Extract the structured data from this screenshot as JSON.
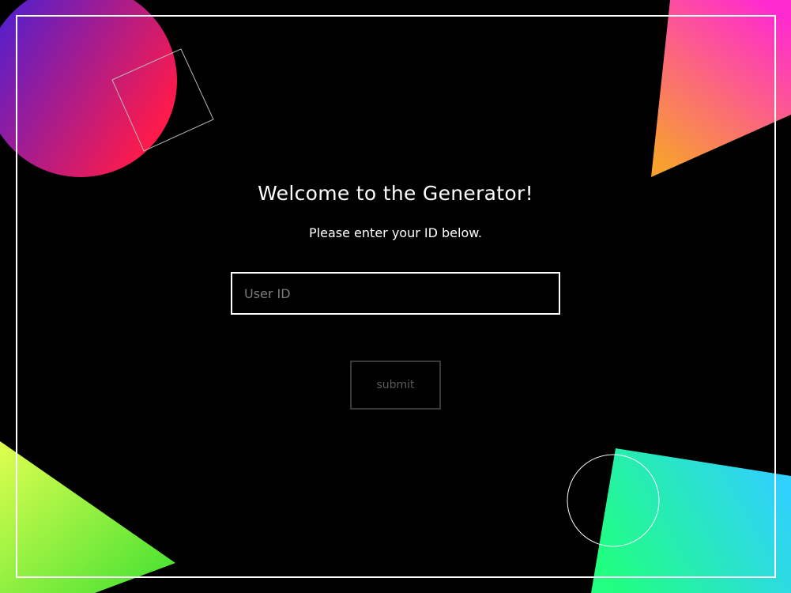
{
  "page": {
    "title": "Welcome to the Generator!",
    "subtitle": "Please enter your ID below."
  },
  "form": {
    "user_id_value": "",
    "user_id_placeholder": "User ID",
    "submit_label": "submit"
  },
  "colors": {
    "background": "#000000",
    "frame": "#ffffff",
    "circle_gradient": [
      "#3a1fe0",
      "#ff1a4a"
    ],
    "top_right_gradient": [
      "#ff2ad0",
      "#f7a030"
    ],
    "bottom_left_gradient": [
      "#e0ff50",
      "#40e030"
    ],
    "bottom_right_gradient": [
      "#20ff80",
      "#30d0ff"
    ]
  }
}
